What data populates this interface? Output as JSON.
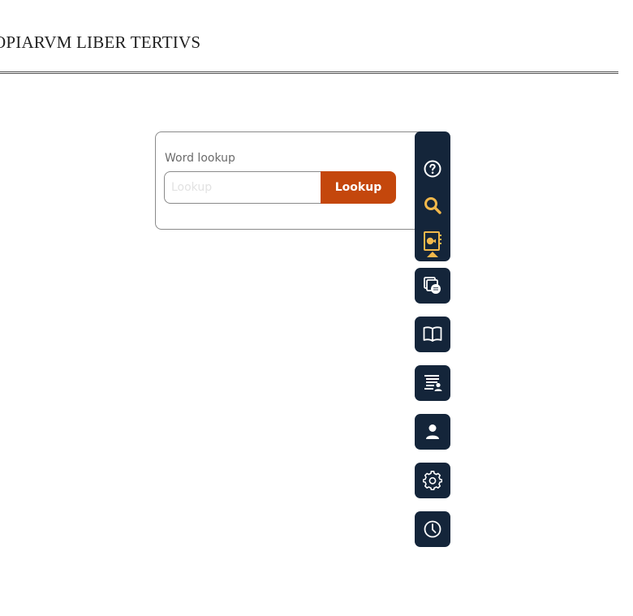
{
  "page": {
    "title": "OPIARVM LIBER TERTIVS"
  },
  "lookup": {
    "label": "Word lookup",
    "input_placeholder": "Lookup",
    "input_value": "",
    "button_label": "Lookup"
  },
  "toolbar": {
    "items": [
      {
        "icon": "help-icon",
        "active": false
      },
      {
        "icon": "search-icon",
        "active": true
      },
      {
        "icon": "notebook-icon",
        "active": true
      },
      {
        "icon": "flashcards-icon",
        "active": false
      },
      {
        "icon": "book-icon",
        "active": false
      },
      {
        "icon": "list-user-icon",
        "active": false
      },
      {
        "icon": "user-icon",
        "active": false
      },
      {
        "icon": "gear-icon",
        "active": false
      },
      {
        "icon": "clock-icon",
        "active": false
      }
    ]
  },
  "colors": {
    "toolbar_bg": "#14253a",
    "accent": "#f2b84b",
    "lookup_button": "#c4470c",
    "icon_default": "#ffffff"
  }
}
